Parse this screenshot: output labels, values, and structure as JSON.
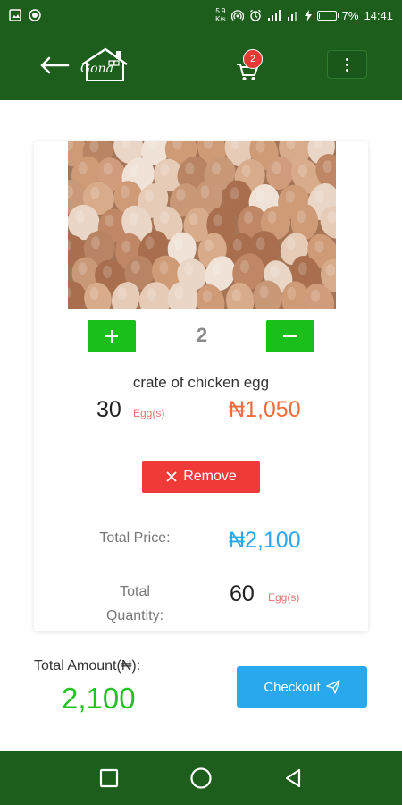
{
  "status_bar": {
    "net_speed_value": "5.9",
    "net_speed_unit": "K/s",
    "battery_text": "7%",
    "time": "14:41"
  },
  "header": {
    "logo_text": "Gona",
    "cart_badge": "2",
    "colors": {
      "bar": "#1d5e1d",
      "badge": "#e53935"
    }
  },
  "product": {
    "image_icon": "eggs-photo",
    "quantity": "2",
    "name": "crate of chicken egg",
    "unit_count": "30",
    "unit_label": "Egg(s)",
    "unit_price": "₦1,050",
    "remove_label": "Remove"
  },
  "summary": {
    "total_price_label": "Total Price:",
    "total_price_value": "₦2,100",
    "total_qty_label_line1": "Total",
    "total_qty_label_line2": "Quantity:",
    "total_qty_value": "60",
    "total_qty_unit": "Egg(s)"
  },
  "footer": {
    "total_amount_label": "Total Amount(₦):",
    "total_amount_value": "2,100",
    "checkout_label": "Checkout"
  },
  "battery_level": 0.07
}
